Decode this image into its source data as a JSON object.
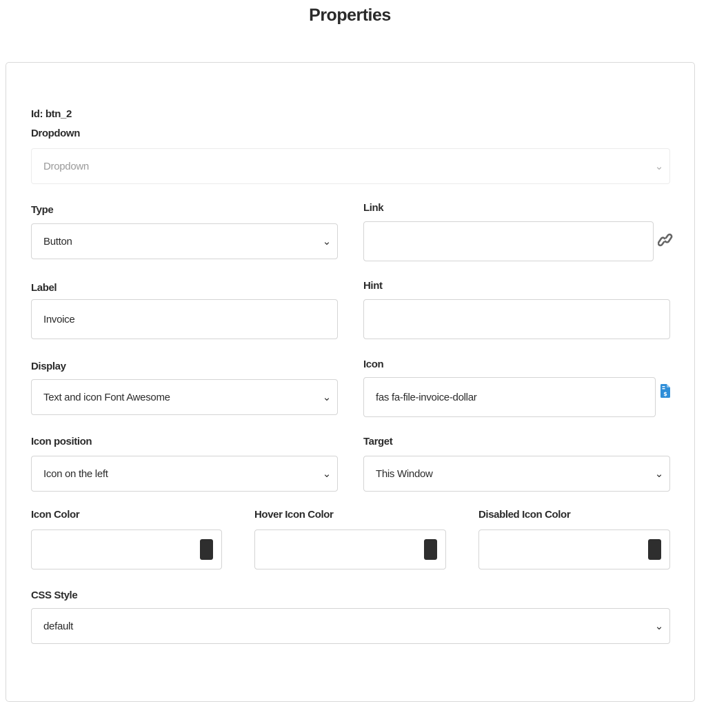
{
  "page": {
    "title": "Properties"
  },
  "properties": {
    "id_text": "Id: btn_2",
    "dropdown": {
      "label": "Dropdown",
      "placeholder": "Dropdown"
    },
    "type": {
      "label": "Type",
      "value": "Button"
    },
    "link": {
      "label": "Link",
      "value": ""
    },
    "label": {
      "label": "Label",
      "value": "Invoice"
    },
    "hint": {
      "label": "Hint",
      "value": ""
    },
    "display": {
      "label": "Display",
      "value": "Text and icon Font Awesome"
    },
    "icon": {
      "label": "Icon",
      "value": "fas fa-file-invoice-dollar"
    },
    "icon_position": {
      "label": "Icon position",
      "value": "Icon on the left"
    },
    "target": {
      "label": "Target",
      "value": "This Window"
    },
    "icon_color": {
      "label": "Icon Color",
      "value": "",
      "swatch": "#2e2e2e"
    },
    "hover_icon_color": {
      "label": "Hover Icon Color",
      "value": "",
      "swatch": "#2e2e2e"
    },
    "disabled_icon_color": {
      "label": "Disabled Icon Color",
      "value": "",
      "swatch": "#2e2e2e"
    },
    "css_style": {
      "label": "CSS Style",
      "value": "default"
    }
  },
  "icons": {
    "link_icon": "link-icon",
    "icon_preview": "file-invoice-dollar-icon",
    "select_chevron": "chevron-down-icon"
  },
  "colors": {
    "accent_blue": "#2f8ed8",
    "link_icon": "#666666"
  }
}
